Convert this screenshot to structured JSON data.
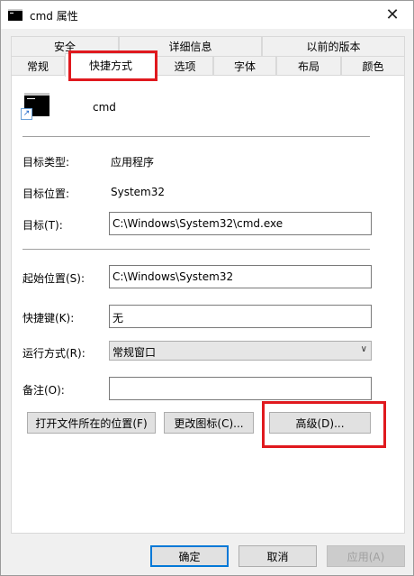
{
  "window": {
    "title": "cmd 属性",
    "close_label": "✕"
  },
  "tabs_top": [
    "安全",
    "详细信息",
    "以前的版本"
  ],
  "tabs_bottom": [
    "常规",
    "快捷方式",
    "选项",
    "字体",
    "布局",
    "颜色"
  ],
  "active_tab": "快捷方式",
  "app": {
    "name": "cmd",
    "icon": "console-icon"
  },
  "fields": {
    "target_type_label": "目标类型:",
    "target_type_value": "应用程序",
    "target_location_label": "目标位置:",
    "target_location_value": "System32",
    "target_label": "目标(T):",
    "target_value": "C:\\Windows\\System32\\cmd.exe",
    "start_in_label": "起始位置(S):",
    "start_in_value": "C:\\Windows\\System32",
    "shortcut_key_label": "快捷键(K):",
    "shortcut_key_value": "无",
    "run_label": "运行方式(R):",
    "run_value": "常规窗口",
    "comment_label": "备注(O):",
    "comment_value": ""
  },
  "buttons": {
    "open_location": "打开文件所在的位置(F)",
    "change_icon": "更改图标(C)...",
    "advanced": "高级(D)...",
    "ok": "确定",
    "cancel": "取消",
    "apply": "应用(A)"
  },
  "colors": {
    "highlight": "#e0191e",
    "accent": "#0078d7"
  }
}
